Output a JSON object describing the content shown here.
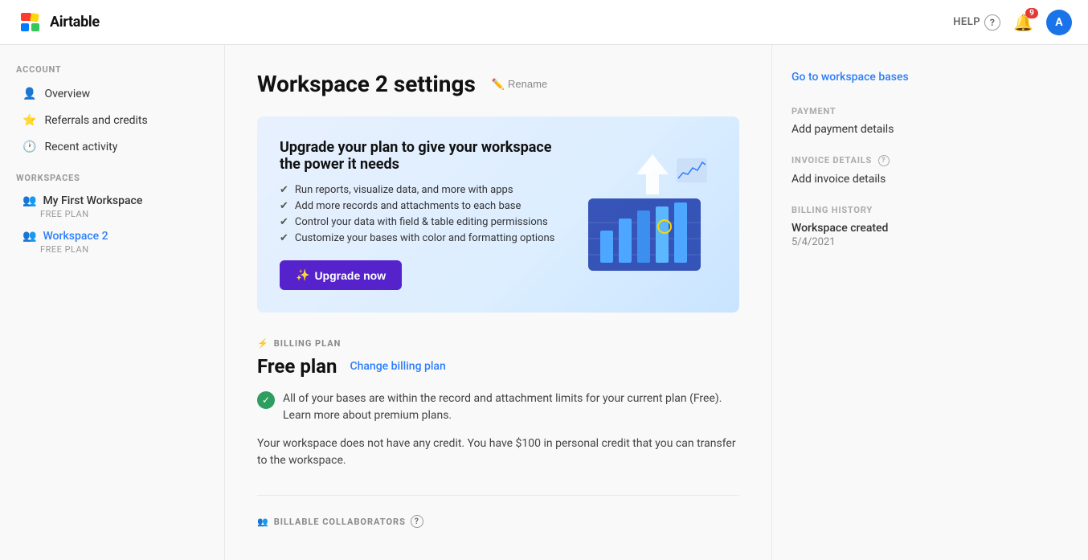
{
  "topnav": {
    "logo_text": "Airtable",
    "help_label": "HELP",
    "help_icon": "?",
    "bell_badge": "9",
    "avatar_letter": "A"
  },
  "sidebar": {
    "account_label": "ACCOUNT",
    "workspaces_label": "WORKSPACES",
    "items": [
      {
        "id": "overview",
        "label": "Overview",
        "icon": "👤"
      },
      {
        "id": "referrals",
        "label": "Referrals and credits",
        "icon": "⭐"
      },
      {
        "id": "activity",
        "label": "Recent activity",
        "icon": "🕐"
      }
    ],
    "workspaces": [
      {
        "id": "ws1",
        "name": "My First Workspace",
        "plan": "FREE PLAN",
        "active": false
      },
      {
        "id": "ws2",
        "name": "Workspace 2",
        "plan": "FREE PLAN",
        "active": true
      }
    ]
  },
  "main": {
    "page_title": "Workspace 2 settings",
    "rename_label": "Rename",
    "upgrade_card": {
      "title": "Upgrade your plan to give your workspace the power it needs",
      "features": [
        "Run reports, visualize data, and more with apps",
        "Add more records and attachments to each base",
        "Control your data with field & table editing permissions",
        "Customize your bases with color and formatting options"
      ],
      "button_label": "Upgrade now",
      "button_icon": "✨"
    },
    "billing_section": {
      "label": "BILLING PLAN",
      "label_icon": "⚡",
      "plan_name": "Free plan",
      "change_link": "Change billing plan",
      "status_text": "All of your bases are within the record and attachment limits for your current plan (Free). Learn more about premium plans.",
      "credit_text": "Your workspace does not have any credit. You have $100 in personal credit that you can transfer to the workspace."
    },
    "billable_section": {
      "label": "BILLABLE COLLABORATORS",
      "help_icon": "?"
    }
  },
  "right_panel": {
    "go_to_bases": "Go to workspace bases",
    "payment_label": "PAYMENT",
    "payment_link": "Add payment details",
    "invoice_label": "INVOICE DETAILS",
    "invoice_help": "?",
    "invoice_link": "Add invoice details",
    "billing_history_label": "BILLING HISTORY",
    "billing_history_item": "Workspace created",
    "billing_history_date": "5/4/2021"
  }
}
